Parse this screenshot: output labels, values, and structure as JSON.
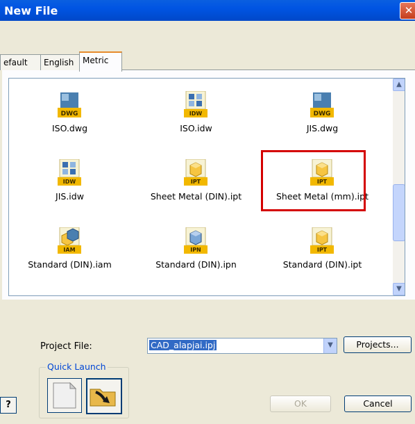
{
  "window": {
    "title": "New File",
    "close_symbol": "✕"
  },
  "tabs": [
    {
      "label": "efault"
    },
    {
      "label": "English"
    },
    {
      "label": "Metric"
    }
  ],
  "items": [
    {
      "label": "ISO.dwg",
      "badge": "DWG",
      "icon": "dwg-icon"
    },
    {
      "label": "ISO.idw",
      "badge": "IDW",
      "icon": "idw-icon"
    },
    {
      "label": "JIS.dwg",
      "badge": "DWG",
      "icon": "dwg-icon"
    },
    {
      "label": "JIS.idw",
      "badge": "IDW",
      "icon": "idw-icon"
    },
    {
      "label": "Sheet Metal (DIN).ipt",
      "badge": "IPT",
      "icon": "ipt-icon"
    },
    {
      "label": "Sheet Metal (mm).ipt",
      "badge": "IPT",
      "icon": "ipt-icon"
    },
    {
      "label": "Standard (DIN).iam",
      "badge": "IAM",
      "icon": "iam-icon"
    },
    {
      "label": "Standard (DIN).ipn",
      "badge": "IPN",
      "icon": "ipn-icon"
    },
    {
      "label": "Standard (DIN).ipt",
      "badge": "IPT",
      "icon": "ipt-icon"
    }
  ],
  "project": {
    "label": "Project File:",
    "value": "CAD_alapjai.ipj",
    "projects_button": "Projects..."
  },
  "quick_launch": {
    "title": "Quick Launch"
  },
  "buttons": {
    "ok": "OK",
    "cancel": "Cancel",
    "help": "?"
  },
  "colors": {
    "title_bar": "#0054e3",
    "selection_highlight": "#d40000",
    "tab_accent": "#e68b2c"
  }
}
